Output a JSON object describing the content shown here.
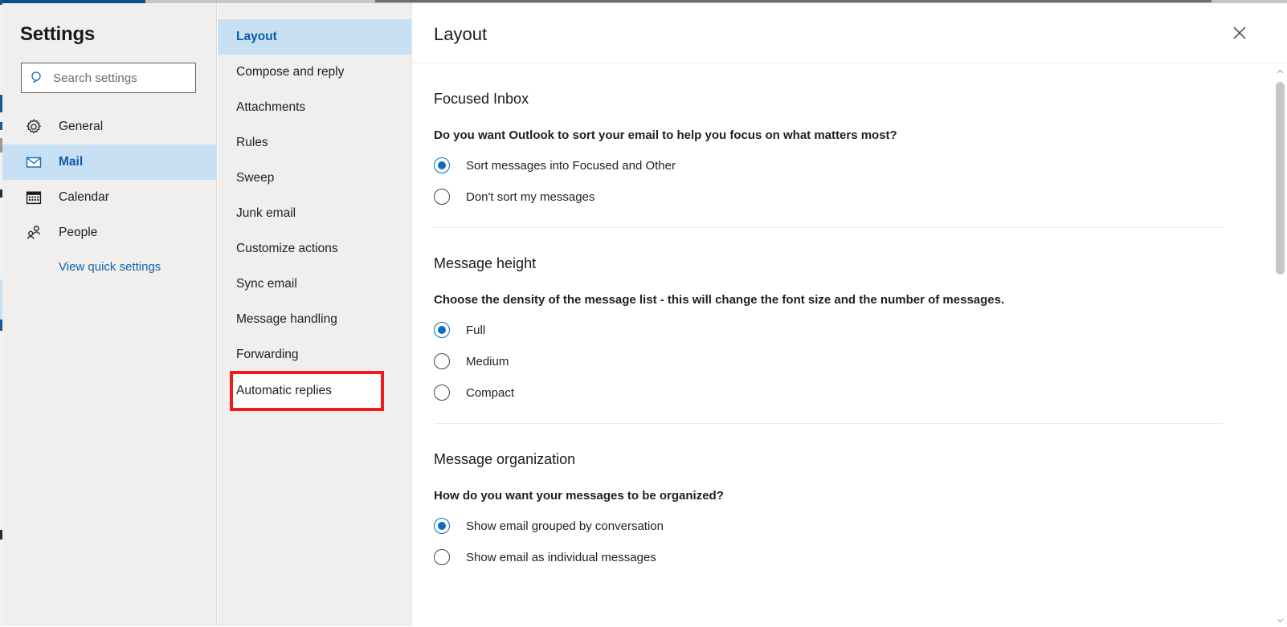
{
  "theme": {
    "accent_blue": "#0f6cbd",
    "link_blue": "#1064ab",
    "selected_bg": "#c7e0f4",
    "sidebar_bg": "#f0efee",
    "highlight_red": "#f01c1c",
    "top_accent": "#0d4f87"
  },
  "sidebar": {
    "title": "Settings",
    "search": {
      "placeholder": "Search settings",
      "value": "",
      "icon": "search-icon"
    },
    "items": [
      {
        "label": "General",
        "icon": "gear-icon",
        "selected": false
      },
      {
        "label": "Mail",
        "icon": "envelope-icon",
        "selected": true
      },
      {
        "label": "Calendar",
        "icon": "calendar-icon",
        "selected": false
      },
      {
        "label": "People",
        "icon": "people-icon",
        "selected": false
      }
    ],
    "quick_settings_link": "View quick settings"
  },
  "subnav": {
    "items": [
      {
        "label": "Layout",
        "selected": true,
        "highlighted": false
      },
      {
        "label": "Compose and reply",
        "selected": false,
        "highlighted": false
      },
      {
        "label": "Attachments",
        "selected": false,
        "highlighted": false
      },
      {
        "label": "Rules",
        "selected": false,
        "highlighted": false
      },
      {
        "label": "Sweep",
        "selected": false,
        "highlighted": false
      },
      {
        "label": "Junk email",
        "selected": false,
        "highlighted": false
      },
      {
        "label": "Customize actions",
        "selected": false,
        "highlighted": false
      },
      {
        "label": "Sync email",
        "selected": false,
        "highlighted": false
      },
      {
        "label": "Message handling",
        "selected": false,
        "highlighted": false
      },
      {
        "label": "Forwarding",
        "selected": false,
        "highlighted": false
      },
      {
        "label": "Automatic replies",
        "selected": false,
        "highlighted": true
      }
    ]
  },
  "content": {
    "title": "Layout",
    "close_label": "close-icon",
    "sections": [
      {
        "title": "Focused Inbox",
        "question": "Do you want Outlook to sort your email to help you focus on what matters most?",
        "options": [
          {
            "label": "Sort messages into Focused and Other",
            "checked": true
          },
          {
            "label": "Don't sort my messages",
            "checked": false
          }
        ]
      },
      {
        "title": "Message height",
        "question": "Choose the density of the message list - this will change the font size and the number of messages.",
        "options": [
          {
            "label": "Full",
            "checked": true
          },
          {
            "label": "Medium",
            "checked": false
          },
          {
            "label": "Compact",
            "checked": false
          }
        ]
      },
      {
        "title": "Message organization",
        "question": "How do you want your messages to be organized?",
        "options": [
          {
            "label": "Show email grouped by conversation",
            "checked": true
          },
          {
            "label": "Show email as individual messages",
            "checked": false
          }
        ]
      }
    ]
  },
  "scrollbar": {
    "up_arrow": "chevron-up-icon",
    "down_arrow": "chevron-down-icon"
  }
}
